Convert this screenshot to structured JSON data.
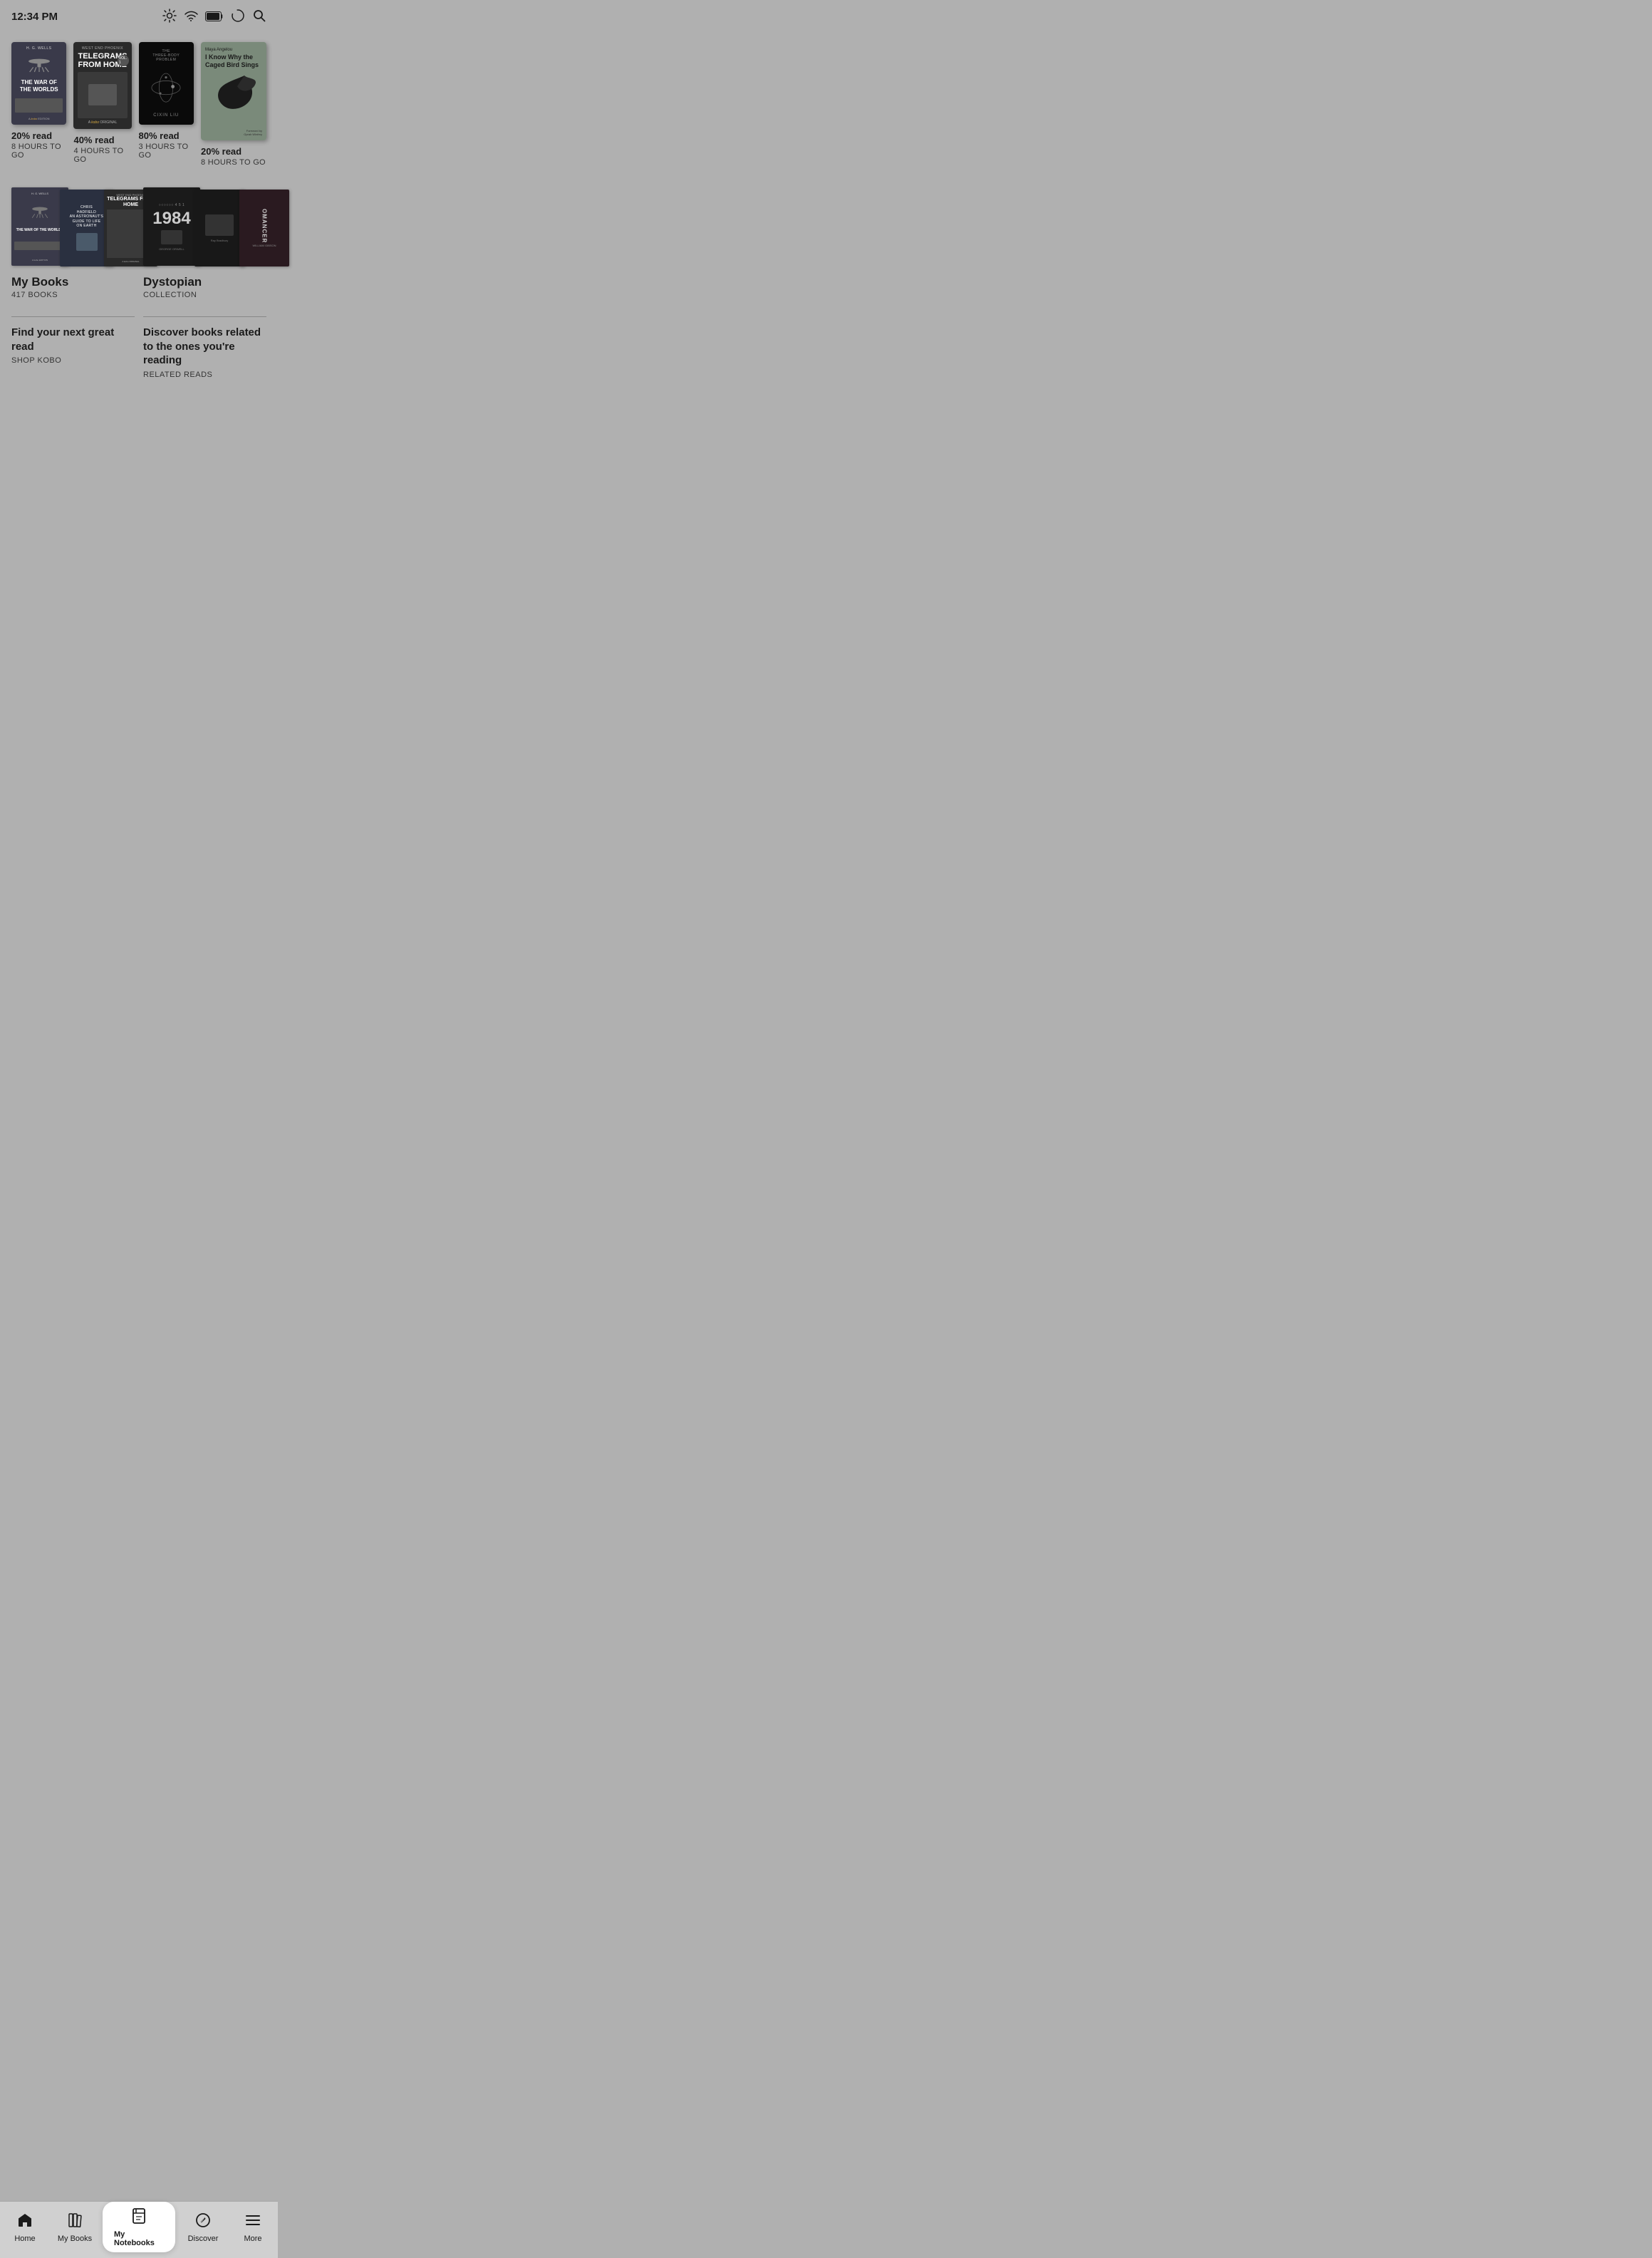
{
  "statusBar": {
    "time": "12:34 PM"
  },
  "currentlyReading": [
    {
      "id": "war-of-worlds",
      "title": "The War of the Worlds",
      "author": "H. G. Wells",
      "progress": "20% read",
      "timeLeft": "8 Hours to Go",
      "coverType": "war-of-worlds"
    },
    {
      "id": "telegrams-from-home",
      "title": "Telegrams from Home",
      "subtitle": "West End Phoenix",
      "progress": "40% read",
      "timeLeft": "4 Hours to Go",
      "coverType": "telegrams"
    },
    {
      "id": "three-body-problem",
      "title": "The Three-Body Problem",
      "author": "Cixin Liu",
      "progress": "80% read",
      "timeLeft": "3 Hours to Go",
      "coverType": "three-body"
    },
    {
      "id": "caged-bird-sings",
      "title": "I Know Why the Caged Bird Sings",
      "author": "Maya Angelou",
      "foreword": "Foreword by Oprah Winfrey",
      "progress": "20% read",
      "timeLeft": "8 Hours to Go",
      "coverType": "caged-bird"
    }
  ],
  "library": [
    {
      "id": "my-books",
      "title": "My Books",
      "count": "417 Books",
      "type": "library"
    },
    {
      "id": "dystopian",
      "title": "Dystopian",
      "type": "collection",
      "typeLabel": "Collection"
    }
  ],
  "promos": [
    {
      "id": "shop-kobo",
      "title": "Find your next great read",
      "label": "Shop Kobo"
    },
    {
      "id": "related-reads",
      "title": "Discover books related to the ones you're reading",
      "label": "Related Reads"
    }
  ],
  "nav": {
    "items": [
      {
        "id": "home",
        "label": "Home",
        "icon": "home",
        "active": false
      },
      {
        "id": "my-books",
        "label": "My Books",
        "icon": "books",
        "active": false
      },
      {
        "id": "my-notebooks",
        "label": "My Notebooks",
        "icon": "notebook",
        "active": true
      },
      {
        "id": "discover",
        "label": "Discover",
        "icon": "compass",
        "active": false
      },
      {
        "id": "more",
        "label": "More",
        "icon": "menu",
        "active": false
      }
    ]
  }
}
